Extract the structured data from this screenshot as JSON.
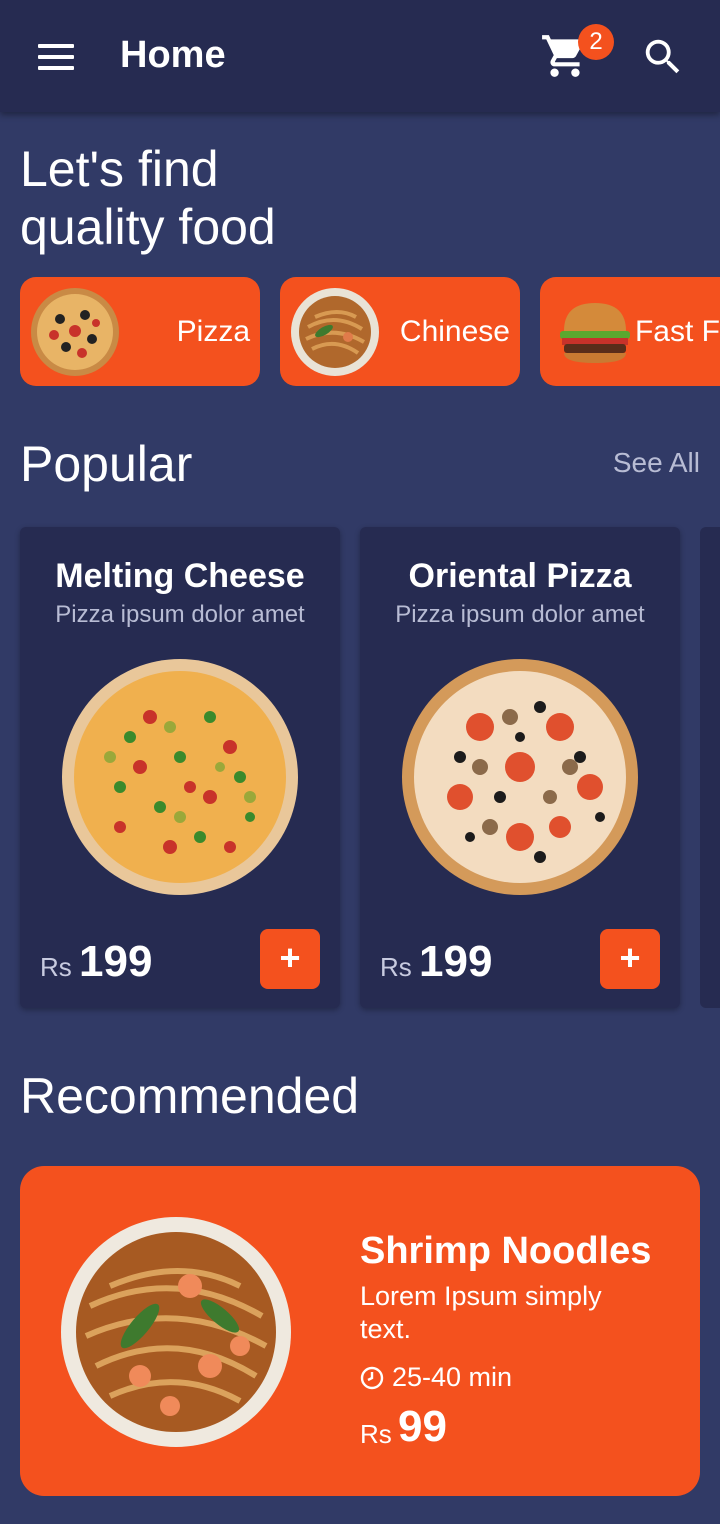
{
  "appbar": {
    "title": "Home",
    "menu_icon": "hamburger-menu-icon",
    "cart_icon": "shopping-cart-icon",
    "cart_count": "2",
    "search_icon": "search-icon"
  },
  "headline": {
    "line1": "Let's find",
    "line2": "quality food"
  },
  "categories": [
    {
      "label": "Pizza",
      "image": "pizza-image"
    },
    {
      "label": "Chinese",
      "image": "noodles-image"
    },
    {
      "label": "Fast Food",
      "image": "burger-image"
    }
  ],
  "popular": {
    "title": "Popular",
    "see_all": "See All",
    "items": [
      {
        "name": "Melting Cheese",
        "desc": "Pizza ipsum dolor amet",
        "currency": "Rs",
        "price": "199",
        "add": "+"
      },
      {
        "name": "Oriental Pizza",
        "desc": "Pizza ipsum dolor amet",
        "currency": "Rs",
        "price": "199",
        "add": "+"
      }
    ]
  },
  "recommended": {
    "title": "Recommended",
    "item": {
      "name": "Shrimp Noodles",
      "desc": "Lorem Ipsum simply text.",
      "time": "25-40 min",
      "currency": "Rs",
      "price": "99"
    }
  },
  "colors": {
    "background": "#313a66",
    "appbar": "#262b51",
    "card": "#262b51",
    "accent": "#f4511e",
    "muted_text": "#b8bcd4"
  }
}
